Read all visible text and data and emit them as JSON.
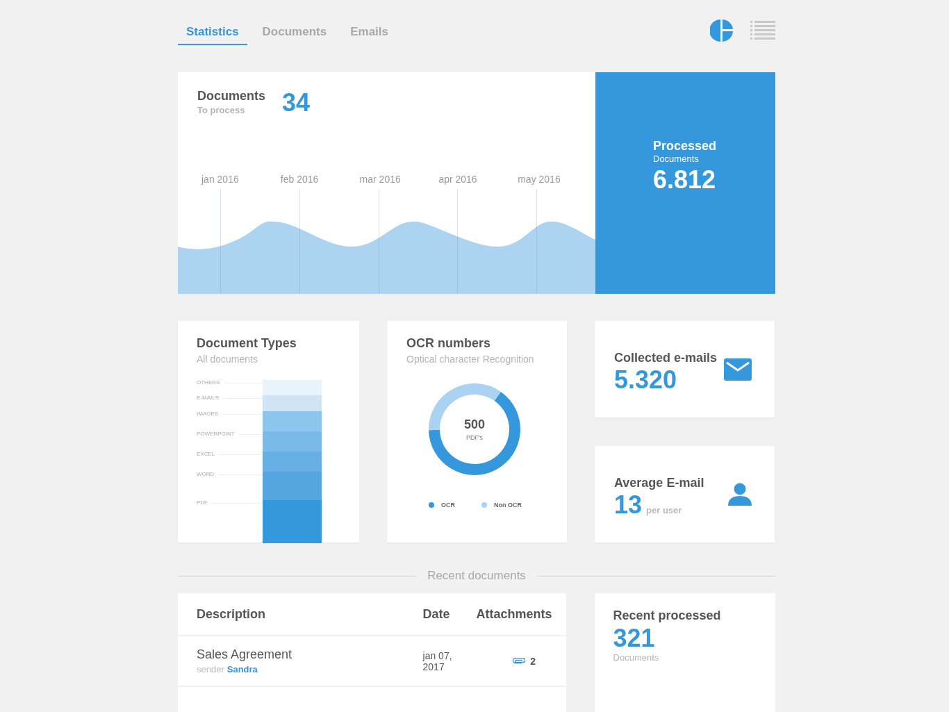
{
  "tabs": [
    {
      "label": "Statistics",
      "selected": true
    },
    {
      "label": "Documents",
      "selected": false
    },
    {
      "label": "Emails",
      "selected": false
    }
  ],
  "to_process": {
    "title": "Documents",
    "subtitle": "To process",
    "value": "34",
    "months": [
      "jan 2016",
      "feb 2016",
      "mar 2016",
      "apr 2016",
      "may 2016"
    ]
  },
  "processed": {
    "title": "Processed",
    "subtitle": "Documents",
    "value": "6.812"
  },
  "document_types": {
    "title": "Document Types",
    "subtitle": "All documents",
    "types": [
      {
        "label": "OTHERS",
        "color": "#e8f3fb"
      },
      {
        "label": "E-MAILS",
        "color": "#cfe5f6"
      },
      {
        "label": "IMAGES",
        "color": "#8ec5ec"
      },
      {
        "label": "POWERPOINT",
        "color": "#7ab9e8"
      },
      {
        "label": "EXCEL",
        "color": "#67afe4"
      },
      {
        "label": "WORD",
        "color": "#55a5e1"
      },
      {
        "label": "PDF",
        "color": "#3598dc"
      }
    ]
  },
  "ocr": {
    "title": "OCR numbers",
    "subtitle": "Optical character Recognition",
    "value": "500",
    "unit": "PDF's",
    "chart_data": {
      "type": "donut",
      "categories": [
        "OCR",
        "Non OCR"
      ],
      "values": [
        65,
        35
      ]
    },
    "legend": [
      {
        "color": "#3598dc"
      },
      {
        "color": "#a9d3f1"
      }
    ]
  },
  "collected": {
    "title": "Collected e-mails",
    "value": "5.320"
  },
  "average": {
    "title": "Average E-mail",
    "value": "13",
    "unit": "per user"
  },
  "section_title": "Recent documents",
  "table": {
    "columns": [
      "Description",
      "Date",
      "Attachments"
    ],
    "rows": [
      {
        "description": "Sales Agreement",
        "sender_label": "sender",
        "sender": "Sandra",
        "date": "jan 07, 2017",
        "attachments": "2"
      }
    ]
  },
  "recent": {
    "title": "Recent processed",
    "value": "321",
    "subtitle": "Documents"
  }
}
